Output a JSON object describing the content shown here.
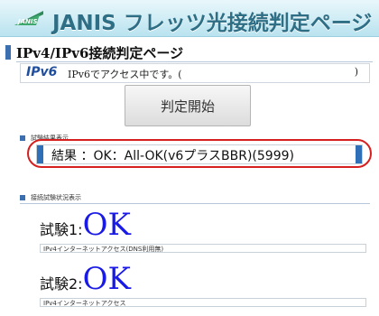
{
  "header": {
    "logo_text": "JANIS",
    "brand_title": "JANIS フレッツ光接続判定ページ"
  },
  "page": {
    "heading": "IPv4/IPv6接続判定ページ"
  },
  "ipv6_status": {
    "logo": "IPv6",
    "text": "IPv6でアクセス中です。(",
    "close_paren": ")"
  },
  "start_button": {
    "label": "判定開始"
  },
  "result_section": {
    "label": "試験結果表示",
    "result_text": "結果 ：OK：All-OK(v6プラスBBR)(5999)"
  },
  "status_section": {
    "label": "接続試験状況表示"
  },
  "tests": [
    {
      "label": "試験1:",
      "status": "OK",
      "description": "IPv4インターネットアクセス(DNS利用無)"
    },
    {
      "label": "試験2:",
      "status": "OK",
      "description": "IPv4インターネットアクセス"
    }
  ],
  "colors": {
    "accent_blue": "#2f6fb8",
    "highlight_red": "#d61f1f",
    "ok_blue": "#1a1ae6"
  }
}
